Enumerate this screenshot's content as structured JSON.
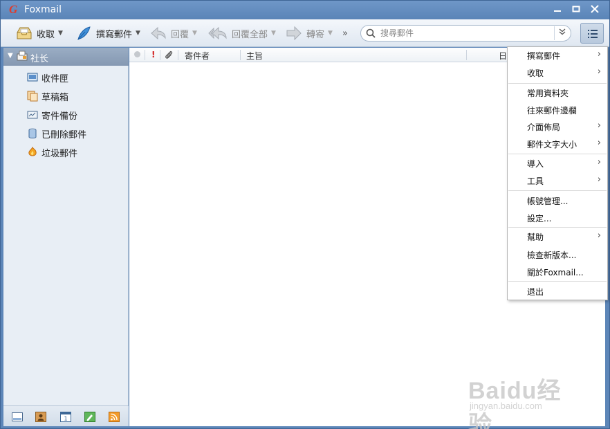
{
  "window": {
    "title": "Foxmail",
    "logo_glyph": "G",
    "controls": {
      "minimize": "▬",
      "maximize": "□",
      "close": "✕"
    }
  },
  "toolbar": {
    "receive": "收取",
    "compose": "撰寫郵件",
    "reply": "回覆",
    "reply_all": "回覆全部",
    "forward": "轉寄",
    "more": "»",
    "search_placeholder": "搜尋郵件"
  },
  "account": {
    "name": "社长"
  },
  "folders": [
    {
      "label": "收件匣",
      "icon": "inbox-icon"
    },
    {
      "label": "草稿箱",
      "icon": "drafts-icon"
    },
    {
      "label": "寄件備份",
      "icon": "sent-icon"
    },
    {
      "label": "已刪除郵件",
      "icon": "trash-icon"
    },
    {
      "label": "垃圾郵件",
      "icon": "junk-icon"
    }
  ],
  "bottom_icons": [
    "mail-icon",
    "contacts-icon",
    "calendar-icon",
    "notes-icon",
    "rss-icon"
  ],
  "columns": {
    "flag": "!",
    "sender": "寄件者",
    "subject": "主旨",
    "date": "日"
  },
  "menu": {
    "items": [
      {
        "label": "撰寫郵件",
        "submenu": true
      },
      {
        "label": "收取",
        "submenu": true
      },
      {
        "label": "常用資料夾",
        "submenu": false
      },
      {
        "label": "往來郵件邊欄",
        "submenu": false
      },
      {
        "label": "介面佈局",
        "submenu": true
      },
      {
        "label": "郵件文字大小",
        "submenu": true
      },
      {
        "label": "導入",
        "submenu": true
      },
      {
        "label": "工具",
        "submenu": true
      },
      {
        "label": "帳號管理...",
        "submenu": false
      },
      {
        "label": "設定...",
        "submenu": false
      },
      {
        "label": "幫助",
        "submenu": true
      },
      {
        "label": "檢查新版本...",
        "submenu": false
      },
      {
        "label": "關於Foxmail...",
        "submenu": false
      },
      {
        "label": "退出",
        "submenu": false
      }
    ],
    "submenu_glyph": "›"
  },
  "watermark": {
    "line1": "Baidu经验",
    "line2": "jingyan.baidu.com"
  },
  "colors": {
    "titlebar": "#5a84b7",
    "accent": "#e13b2b"
  }
}
